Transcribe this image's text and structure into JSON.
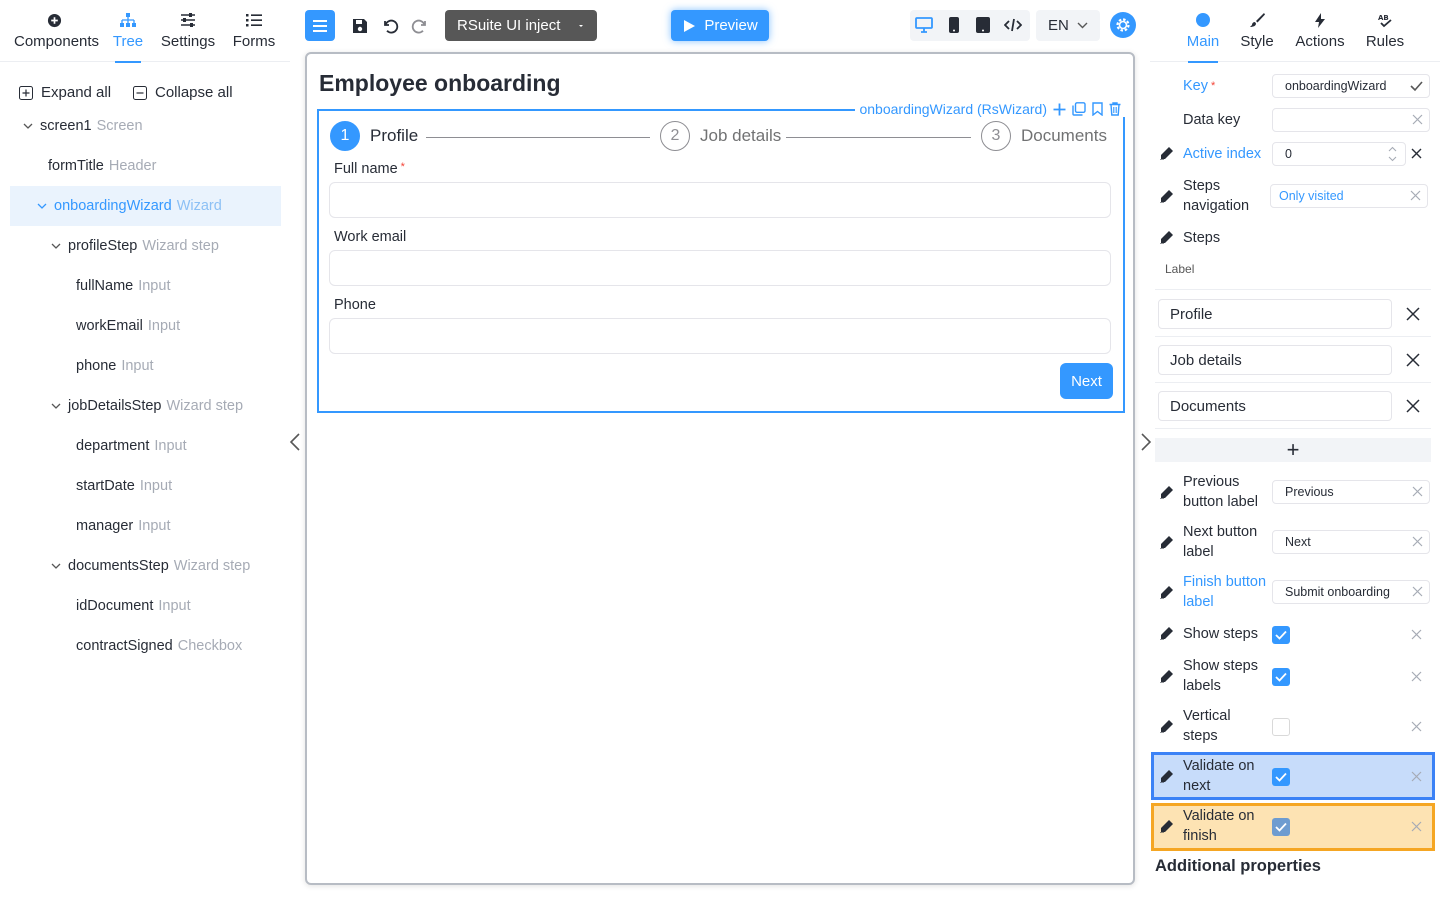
{
  "left_panel": {
    "tabs": [
      {
        "label": "Components",
        "icon": "plus-circle-icon"
      },
      {
        "label": "Tree",
        "icon": "sitemap-icon"
      },
      {
        "label": "Settings",
        "icon": "sliders-icon"
      },
      {
        "label": "Forms",
        "icon": "list-icon"
      }
    ],
    "active_tab": "Tree",
    "expand_all": "Expand all",
    "collapse_all": "Collapse all",
    "tree": [
      {
        "name": "screen1",
        "type": "Screen",
        "expanded": true
      },
      {
        "name": "formTitle",
        "type": "Header"
      },
      {
        "name": "onboardingWizard",
        "type": "Wizard",
        "expanded": true,
        "selected": true
      },
      {
        "name": "profileStep",
        "type": "Wizard step",
        "expanded": true
      },
      {
        "name": "fullName",
        "type": "Input"
      },
      {
        "name": "workEmail",
        "type": "Input"
      },
      {
        "name": "phone",
        "type": "Input"
      },
      {
        "name": "jobDetailsStep",
        "type": "Wizard step",
        "expanded": true
      },
      {
        "name": "department",
        "type": "Input"
      },
      {
        "name": "startDate",
        "type": "Input"
      },
      {
        "name": "manager",
        "type": "Input"
      },
      {
        "name": "documentsStep",
        "type": "Wizard step",
        "expanded": true
      },
      {
        "name": "idDocument",
        "type": "Input"
      },
      {
        "name": "contractSigned",
        "type": "Checkbox"
      }
    ]
  },
  "toolbar": {
    "inject_label": "RSuite UI inject",
    "preview_label": "Preview",
    "language": "EN"
  },
  "canvas": {
    "form_title": "Employee onboarding",
    "wizard_label": "onboardingWizard (RsWizard)",
    "steps": [
      {
        "number": "1",
        "label": "Profile",
        "active": true
      },
      {
        "number": "2",
        "label": "Job details",
        "active": false
      },
      {
        "number": "3",
        "label": "Documents",
        "active": false
      }
    ],
    "fields": [
      {
        "label": "Full name",
        "required": true,
        "value": ""
      },
      {
        "label": "Work email",
        "required": false,
        "value": ""
      },
      {
        "label": "Phone",
        "required": false,
        "value": ""
      }
    ],
    "next_button": "Next"
  },
  "right_panel": {
    "tabs": [
      {
        "label": "Main",
        "icon": "circle-icon"
      },
      {
        "label": "Style",
        "icon": "brush-icon"
      },
      {
        "label": "Actions",
        "icon": "bolt-icon"
      },
      {
        "label": "Rules",
        "icon": "spellcheck-icon"
      }
    ],
    "active_tab": "Main",
    "key_label": "Key",
    "key_value": "onboardingWizard",
    "data_key_label": "Data key",
    "data_key_value": "",
    "active_index_label": "Active index",
    "active_index_value": "0",
    "steps_navigation_label": "Steps navigation",
    "steps_navigation_value": "Only visited",
    "steps_label": "Steps",
    "steps_column_label": "Label",
    "step_labels": [
      "Profile",
      "Job details",
      "Documents"
    ],
    "add_step_symbol": "+",
    "previous_button_label": "Previous button label",
    "previous_button_value": "Previous",
    "next_button_label": "Next button label",
    "next_button_value": "Next",
    "finish_button_label": "Finish button label",
    "finish_button_value": "Submit onboarding",
    "show_steps_label": "Show steps",
    "show_steps_checked": true,
    "show_steps_labels_label": "Show steps labels",
    "show_steps_labels_checked": true,
    "vertical_steps_label": "Vertical steps",
    "vertical_steps_checked": false,
    "validate_on_next_label": "Validate on next",
    "validate_on_next_checked": true,
    "validate_on_finish_label": "Validate on finish",
    "validate_on_finish_checked": true,
    "additional_properties": "Additional properties"
  },
  "colors": {
    "accent": "#3498ff",
    "highlight_blue": "#3b82f6",
    "highlight_orange": "#f5a623",
    "inject_button": "#575757"
  }
}
